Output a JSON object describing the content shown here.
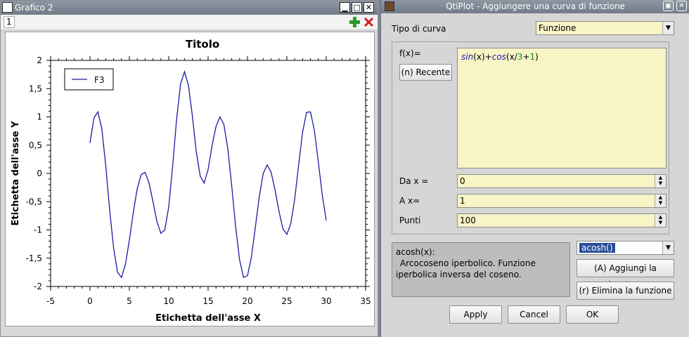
{
  "graph_window": {
    "title": "Grafico 2",
    "layer_tab": "1",
    "controls": {
      "minimize": "▁",
      "maximize": "□",
      "close": "✕"
    }
  },
  "chart_data": {
    "type": "line",
    "title": "Titolo",
    "xlabel": "Etichetta dell'asse X",
    "ylabel": "Etichetta dell'asse Y",
    "xlim": [
      -5,
      35
    ],
    "ylim": [
      -2,
      2
    ],
    "x_ticks": [
      "-5",
      "0",
      "5",
      "10",
      "15",
      "20",
      "25",
      "30",
      "35"
    ],
    "y_ticks": [
      "2",
      "1,5",
      "1",
      "0,5",
      "0",
      "-0,5",
      "-1",
      "-1,5",
      "-2"
    ],
    "legend_position": "top-left",
    "series": [
      {
        "name": "F3",
        "color": "#1a1aa6",
        "x": [
          0,
          0.5,
          1,
          1.5,
          2,
          2.5,
          3,
          3.5,
          4,
          4.5,
          5,
          5.5,
          6,
          6.5,
          7,
          7.5,
          8,
          8.5,
          9,
          9.5,
          10,
          10.5,
          11,
          11.5,
          12,
          12.5,
          13,
          13.5,
          14,
          14.5,
          15,
          15.5,
          16,
          16.5,
          17,
          17.5,
          18,
          18.5,
          19,
          19.5,
          20,
          20.5,
          21,
          21.5,
          22,
          22.5,
          23,
          23.5,
          24,
          24.5,
          25,
          25.5,
          26,
          26.5,
          27,
          27.5,
          28,
          28.5,
          29,
          29.5,
          30
        ],
        "y": [
          0.54,
          0.98,
          1.09,
          0.79,
          0.14,
          -0.65,
          -1.32,
          -1.75,
          -1.84,
          -1.61,
          -1.18,
          -0.69,
          -0.27,
          -0.02,
          0.02,
          -0.17,
          -0.5,
          -0.85,
          -1.06,
          -1.0,
          -0.59,
          0.13,
          0.96,
          1.58,
          1.8,
          1.56,
          1.02,
          0.38,
          -0.05,
          -0.17,
          0.07,
          0.49,
          0.83,
          1.0,
          0.87,
          0.44,
          -0.22,
          -0.95,
          -1.53,
          -1.84,
          -1.81,
          -1.48,
          -0.95,
          -0.41,
          0.0,
          0.15,
          0.02,
          -0.29,
          -0.67,
          -0.98,
          -1.08,
          -0.89,
          -0.45,
          0.15,
          0.73,
          1.08,
          1.09,
          0.76,
          0.2,
          -0.38,
          -0.83
        ]
      }
    ]
  },
  "dialog": {
    "title": "QtiPlot - Aggiungere una curva di funzione",
    "curve_type_label": "Tipo di curva",
    "curve_type_value": "Funzione",
    "fx_label": "f(x)=",
    "recent_button": "(n) Recente",
    "expression": {
      "f1": "sin",
      "p1": "(x)+",
      "f2": "cos",
      "p2": "(x/",
      "n1": "3",
      "p3": "+",
      "n2": "1",
      "p4": ")"
    },
    "from_label": "Da x =",
    "from_value": "0",
    "to_label": "A x=",
    "to_value": "1",
    "points_label": "Punti",
    "points_value": "100",
    "help_title": "acosh(x):",
    "help_body": "Arcocoseno iperbolico. Funzione iperbolica inversa del coseno.",
    "function_select": "acosh()",
    "add_function_button": "(A) Aggiungi la funzione",
    "delete_function_button": "(r) Elimina la funzione",
    "apply_button": "Apply",
    "cancel_button": "Cancel",
    "ok_button": "OK"
  }
}
